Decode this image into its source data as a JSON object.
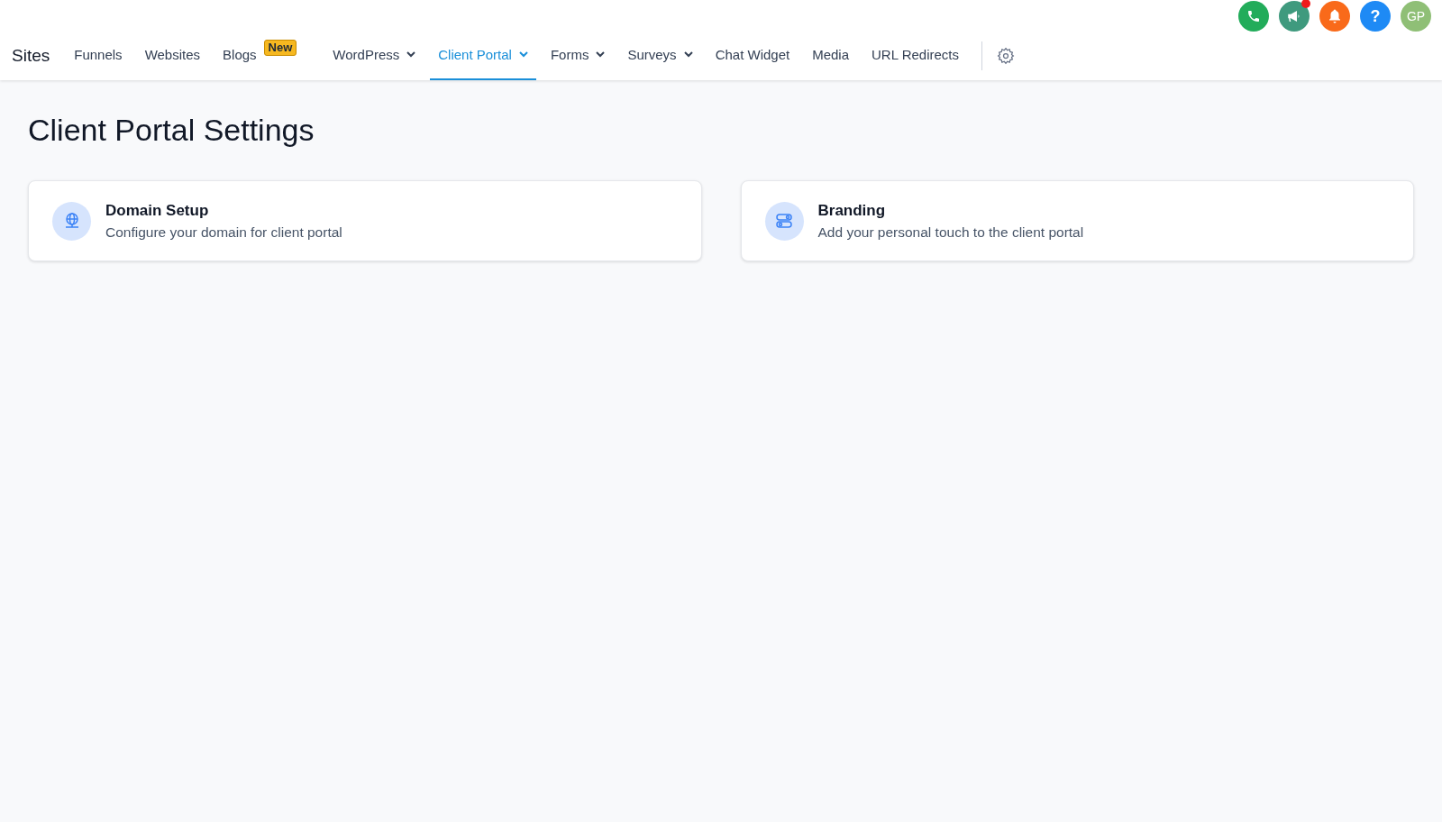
{
  "header_actions": [
    {
      "kind": "phone",
      "color": "#22ac5a",
      "notification": false
    },
    {
      "kind": "megaphone",
      "color": "#3f9a7e",
      "notification": true
    },
    {
      "kind": "bell",
      "color": "#f96a1a",
      "notification": false
    },
    {
      "kind": "help",
      "color": "#1e8af5",
      "notification": false,
      "label": "?"
    },
    {
      "kind": "avatar",
      "color": "#8fbf76",
      "notification": false,
      "label": "GP"
    }
  ],
  "nav": {
    "brand": "Sites",
    "items": [
      {
        "label": "Funnels",
        "selected": false,
        "dropdown": false
      },
      {
        "label": "Websites",
        "selected": false,
        "dropdown": false
      },
      {
        "label": "Blogs",
        "selected": false,
        "dropdown": false,
        "badge": "New"
      },
      {
        "label": "WordPress",
        "selected": false,
        "dropdown": true
      },
      {
        "label": "Client Portal",
        "selected": true,
        "dropdown": true
      },
      {
        "label": "Forms",
        "selected": false,
        "dropdown": true
      },
      {
        "label": "Surveys",
        "selected": false,
        "dropdown": true
      },
      {
        "label": "Chat Widget",
        "selected": false,
        "dropdown": false
      },
      {
        "label": "Media",
        "selected": false,
        "dropdown": false
      },
      {
        "label": "URL Redirects",
        "selected": false,
        "dropdown": false
      }
    ]
  },
  "page": {
    "title": "Client Portal Settings",
    "cards": [
      {
        "kind": "globe",
        "title": "Domain Setup",
        "description": "Configure your domain for client portal"
      },
      {
        "kind": "toggles",
        "title": "Branding",
        "description": "Add your personal touch to the client portal"
      }
    ]
  }
}
